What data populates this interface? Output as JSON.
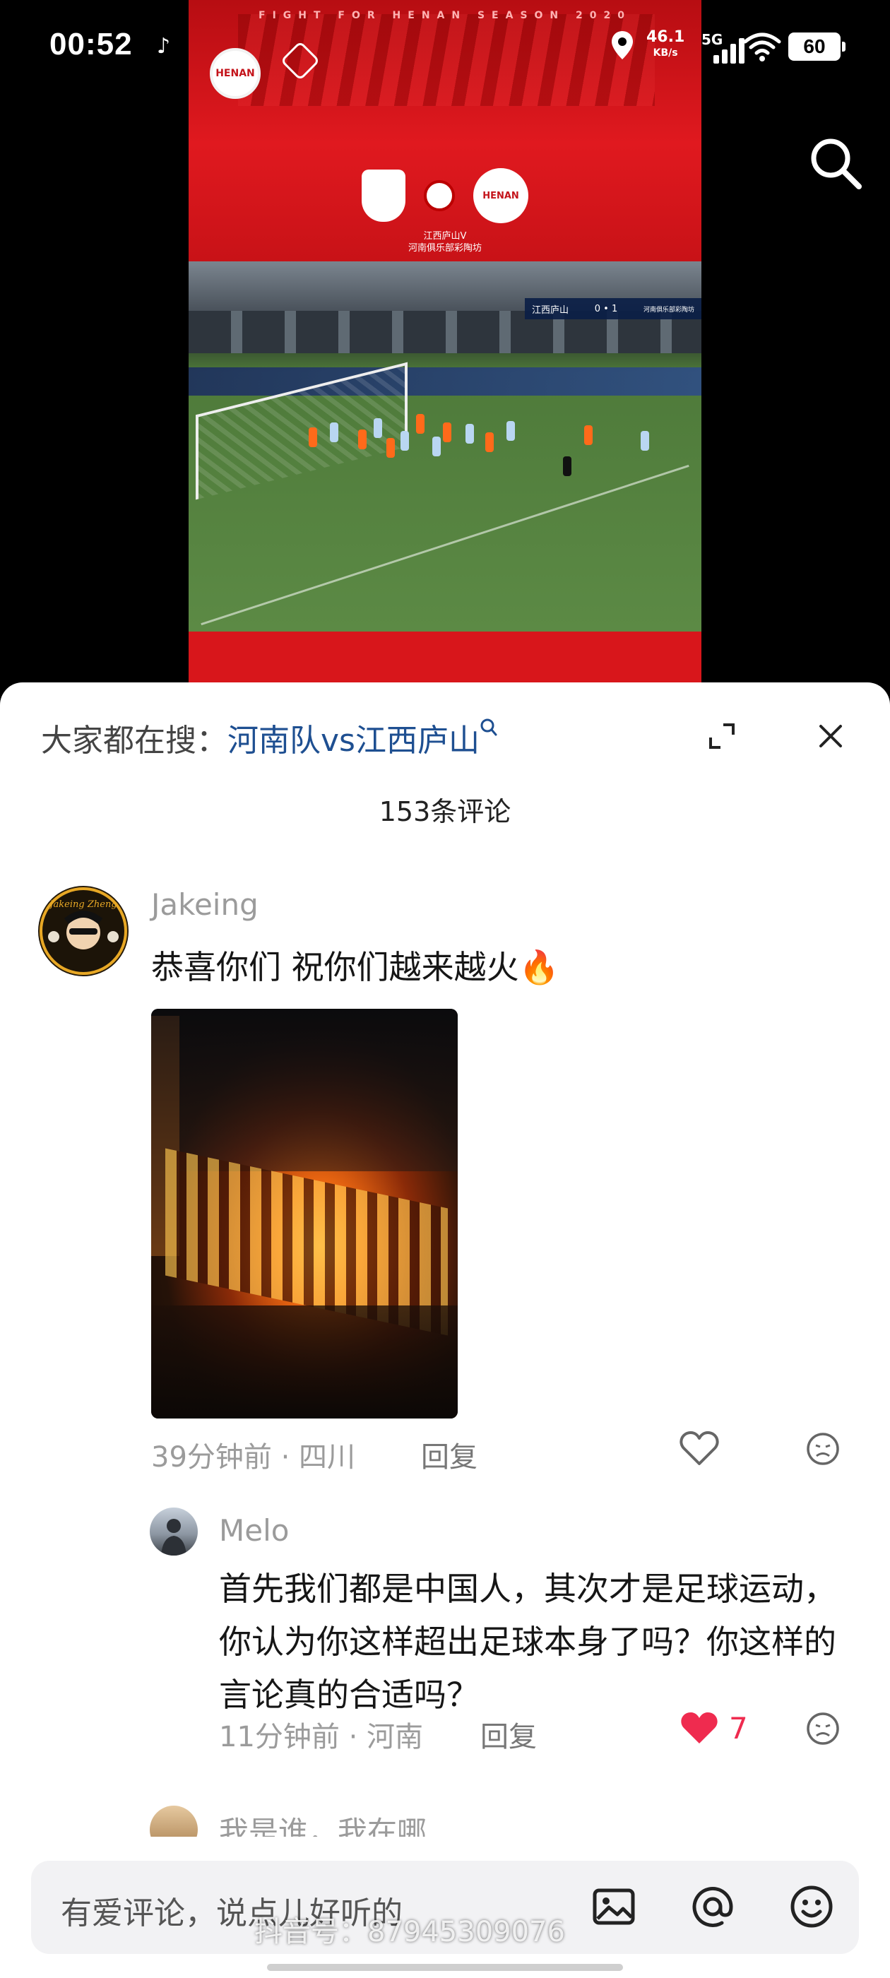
{
  "status_bar": {
    "time": "00:52",
    "net_speed": "46.1",
    "net_unit": "KB/s",
    "network": "5G",
    "battery": "60"
  },
  "video": {
    "banner_top_text": "FIGHT FOR HENAN SEASON 2020",
    "team_logo_text": "HENAN",
    "match_caption_line1": "江西庐山V",
    "match_caption_line2": "河南俱乐部彩陶坊",
    "score_home": "江西庐山",
    "score_value": "0 • 1",
    "score_away": "河南俱乐部彩陶坊"
  },
  "sheet": {
    "search_prefix": "大家都在搜：",
    "search_query": "河南队vs江西庐山",
    "comment_count": "153条评论"
  },
  "comments": [
    {
      "username": "Jakeing",
      "text": "恭喜你们 祝你们越来越火🔥",
      "time_location": "39分钟前 · 四川",
      "reply_label": "回复",
      "avatar_text": "Jakeing Zheng"
    }
  ],
  "replies": [
    {
      "username": "Melo",
      "text": "首先我们都是中国人，其次才是足球运动，你认为你这样超出足球本身了吗？你这样的言论真的合适吗？",
      "time_location": "11分钟前 · 河南",
      "reply_label": "回复",
      "likes": "7"
    }
  ],
  "partial_comment": {
    "username": "我是谁，我在哪"
  },
  "input": {
    "placeholder": "有爱评论，说点儿好听的",
    "watermark": "抖音号：87945309076"
  },
  "colors": {
    "link_blue": "#1e4f91",
    "like_red": "#ef2b4f",
    "video_red": "#d8161b"
  }
}
